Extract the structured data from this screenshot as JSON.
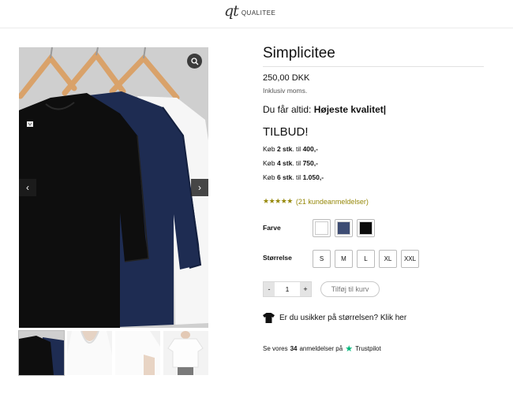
{
  "header": {
    "logo_mark": "qt",
    "logo_text": "QUALITEE"
  },
  "product": {
    "title": "Simplicitee",
    "price": "250,00 DKK",
    "tax_note": "Inklusiv moms.",
    "quality_prefix": "Du får altid:",
    "quality_bold": "Højeste kvalitet|",
    "offer_title": "TILBUD!",
    "offers": [
      {
        "prefix": "Køb ",
        "qty": "2 stk",
        "mid": ". til ",
        "price": "400,-"
      },
      {
        "prefix": "Køb ",
        "qty": "4 stk",
        "mid": ". til ",
        "price": "750,-"
      },
      {
        "prefix": "Køb ",
        "qty": "6 stk",
        "mid": ". til ",
        "price": "1.050,-"
      }
    ],
    "rating_stars": "★★★★★",
    "reviews_text": "(21 kundeanmeldelser)",
    "color_label": "Farve",
    "colors": [
      "#ffffff",
      "#3d4c73",
      "#0b0b0b"
    ],
    "size_label": "Størrelse",
    "sizes": [
      "S",
      "M",
      "L",
      "XL",
      "XXL"
    ],
    "qty_minus": "-",
    "qty_value": "1",
    "qty_plus": "+",
    "add_to_cart": "Tilføj til kurv",
    "size_help": "Er du usikker på størrelsen? Klik her",
    "trust_prefix": "Se vores",
    "trust_count": "34",
    "trust_suffix": "anmeldelser på",
    "trust_brand": "Trustpilot"
  },
  "gallery": {
    "shirt_colors": [
      "#0e0e0e",
      "#1e2c52",
      "#f4f4f4"
    ],
    "icons": {
      "zoom": "magnifier-icon",
      "prev": "chevron-left-icon",
      "next": "chevron-right-icon"
    },
    "arrow_prev": "‹",
    "arrow_next": "›"
  }
}
